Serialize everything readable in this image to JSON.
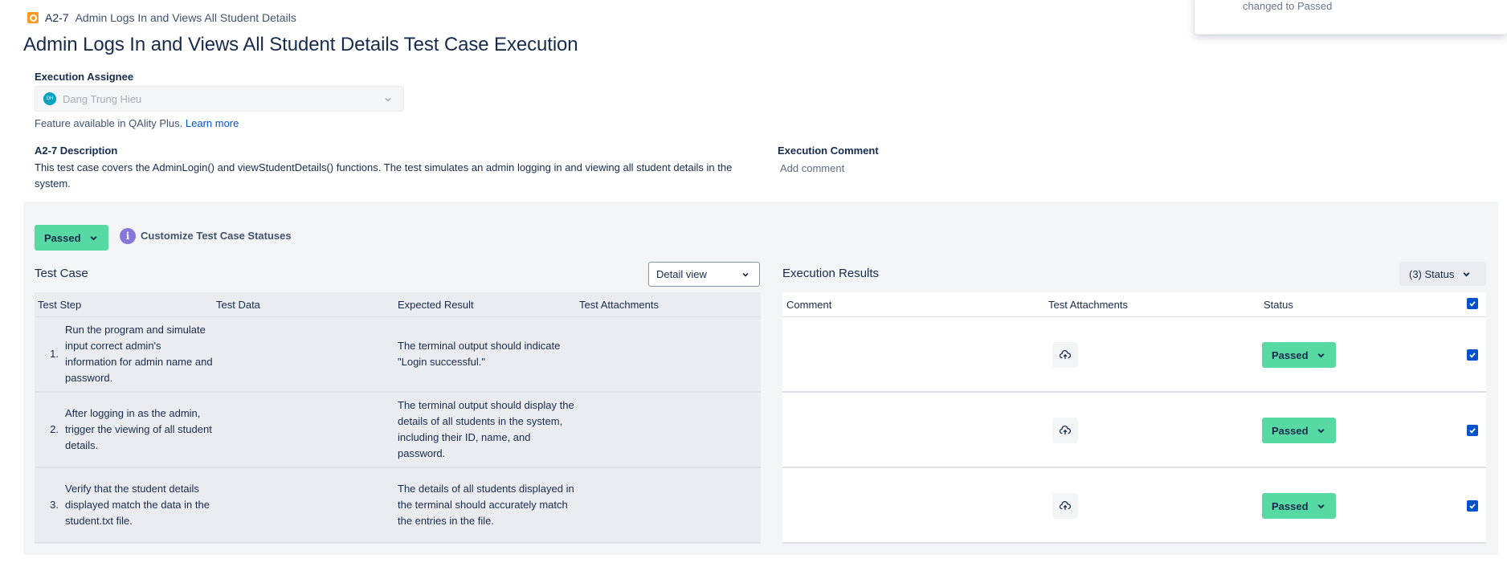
{
  "breadcrumb": {
    "key": "A2-7",
    "title": "Admin Logs In and Views All Student Details"
  },
  "notification": {
    "text": "changed to Passed"
  },
  "page_title": "Admin Logs In and Views All Student Details Test Case Execution",
  "assignee": {
    "label": "Execution Assignee",
    "avatar_initials": "DH",
    "name": "Dang Trung Hieu"
  },
  "feature_note": {
    "text": "Feature available in QAlity Plus.",
    "link": "Learn more"
  },
  "description": {
    "title": "A2-7 Description",
    "body": "This test case covers the AdminLogin() and viewStudentDetails() functions. The test simulates an admin logging in and viewing all student details in the system."
  },
  "execution_comment": {
    "title": "Execution Comment",
    "placeholder": "Add comment"
  },
  "execution_status": {
    "label": "Passed"
  },
  "customize": {
    "label": "Customize Test Case Statuses",
    "icon": "info-icon"
  },
  "test_case": {
    "title": "Test Case",
    "view_select": "Detail view",
    "columns": [
      "Test Step",
      "Test Data",
      "Expected Result",
      "Test Attachments"
    ],
    "rows": [
      {
        "num": "1.",
        "step": "Run the program and simulate input correct admin's information for admin name and password.",
        "data": "",
        "expected": "The terminal output should indicate \"Login successful.\"",
        "attachments": ""
      },
      {
        "num": "2.",
        "step": "After logging in as the admin, trigger the viewing of all student details.",
        "data": "",
        "expected": "The terminal output should display the details of all students in the system, including their ID, name, and password.",
        "attachments": ""
      },
      {
        "num": "3.",
        "step": "Verify that the student details displayed match the data in the student.txt file.",
        "data": "",
        "expected": "The details of all students displayed in the terminal should accurately match the entries in the file.",
        "attachments": ""
      }
    ]
  },
  "execution_results": {
    "title": "Execution Results",
    "status_filter": "(3) Status",
    "columns": [
      "Comment",
      "Test Attachments",
      "Status"
    ],
    "rows": [
      {
        "comment": "",
        "status": "Passed",
        "checked": true
      },
      {
        "comment": "",
        "status": "Passed",
        "checked": true
      },
      {
        "comment": "",
        "status": "Passed",
        "checked": true
      }
    ]
  },
  "colors": {
    "passed": "#57d9a3",
    "accent": "#0052cc",
    "info": "#8777d9",
    "panel": "#f4f5f7"
  }
}
